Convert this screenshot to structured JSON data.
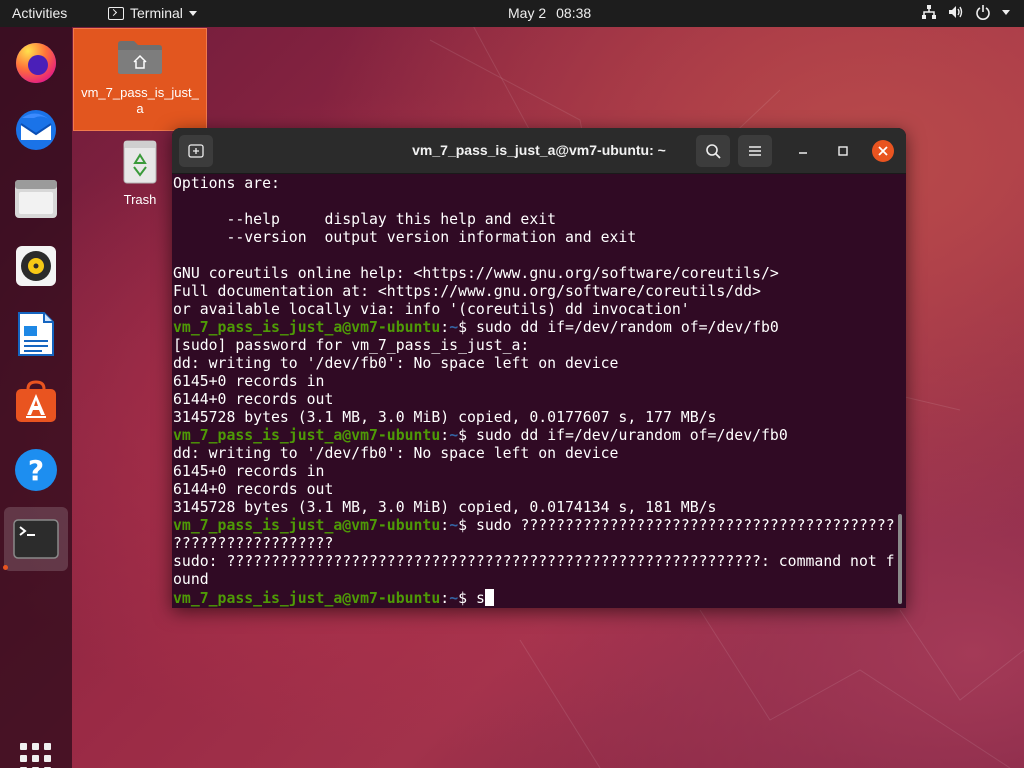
{
  "topbar": {
    "activities": "Activities",
    "app_name": "Terminal",
    "date": "May 2",
    "time": "08:38",
    "tray_icons": [
      "network-icon",
      "volume-icon",
      "power-icon",
      "chevron-down-icon"
    ]
  },
  "dock": {
    "items": [
      {
        "name": "firefox-icon",
        "label": "Firefox"
      },
      {
        "name": "thunderbird-icon",
        "label": "Thunderbird"
      },
      {
        "name": "files-icon",
        "label": "Files"
      },
      {
        "name": "rhythmbox-icon",
        "label": "Rhythmbox"
      },
      {
        "name": "writer-icon",
        "label": "LibreOffice Writer"
      },
      {
        "name": "software-icon",
        "label": "Ubuntu Software"
      },
      {
        "name": "help-icon",
        "label": "Help"
      },
      {
        "name": "terminal-icon",
        "label": "Terminal"
      }
    ],
    "show_apps": "show-applications-icon"
  },
  "desktop": {
    "home_label": "vm_7_pass_is_just_a",
    "trash_label": "Trash"
  },
  "window": {
    "title": "vm_7_pass_is_just_a@vm7-ubuntu: ~"
  },
  "terminal": {
    "prompt_user": "vm_7_pass_is_just_a@vm7-ubuntu",
    "prompt_sep": ":",
    "prompt_path": "~",
    "prompt_sym": "$ ",
    "lines": [
      {
        "text": "Options are:"
      },
      {
        "text": ""
      },
      {
        "text": "      --help     display this help and exit"
      },
      {
        "text": "      --version  output version information and exit"
      },
      {
        "text": ""
      },
      {
        "text": "GNU coreutils online help: <https://www.gnu.org/software/coreutils/>"
      },
      {
        "text": "Full documentation at: <https://www.gnu.org/software/coreutils/dd>"
      },
      {
        "text": "or available locally via: info '(coreutils) dd invocation'"
      },
      {
        "prompt": true,
        "text": "sudo dd if=/dev/random of=/dev/fb0"
      },
      {
        "text": "[sudo] password for vm_7_pass_is_just_a:"
      },
      {
        "text": "dd: writing to '/dev/fb0': No space left on device"
      },
      {
        "text": "6145+0 records in"
      },
      {
        "text": "6144+0 records out"
      },
      {
        "text": "3145728 bytes (3.1 MB, 3.0 MiB) copied, 0.0177607 s, 177 MB/s"
      },
      {
        "prompt": true,
        "text": "sudo dd if=/dev/urandom of=/dev/fb0"
      },
      {
        "text": "dd: writing to '/dev/fb0': No space left on device"
      },
      {
        "text": "6145+0 records in"
      },
      {
        "text": "6144+0 records out"
      },
      {
        "text": "3145728 bytes (3.1 MB, 3.0 MiB) copied, 0.0174134 s, 181 MB/s"
      },
      {
        "prompt": true,
        "text": "sudo ??????????????????????????????????????????"
      },
      {
        "text": "??????????????????"
      },
      {
        "text": "sudo: ????????????????????????????????????????????????????????????: command not f"
      },
      {
        "text": "ound"
      },
      {
        "prompt": true,
        "text": "s",
        "cursor": true
      }
    ]
  }
}
